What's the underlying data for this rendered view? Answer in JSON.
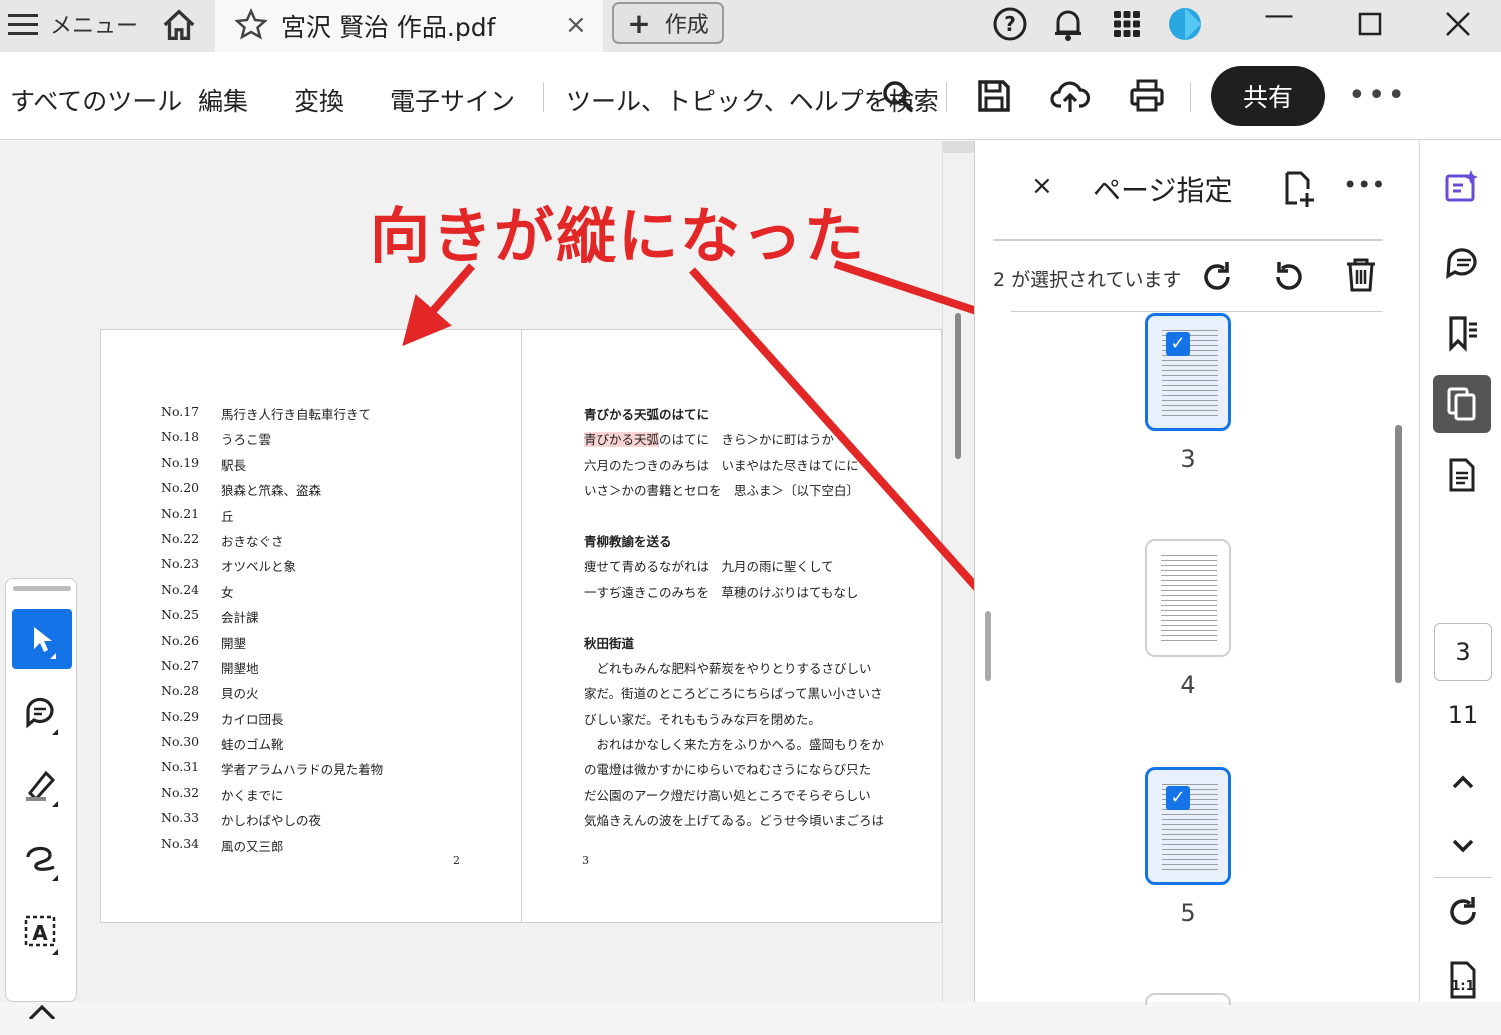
{
  "titlebar": {
    "menu_label": "メニュー",
    "tab_name": "宮沢 賢治 作品.pdf",
    "tab_close": "×",
    "create_label": "作成",
    "create_plus": "+"
  },
  "toolbar": {
    "all_tools": "すべてのツール",
    "edit": "編集",
    "convert": "変換",
    "esign": "電子サイン",
    "search": "ツール、トピック、ヘルプを検索",
    "share": "共有",
    "more": "•••"
  },
  "annotation": {
    "text": "向きが縦になった",
    "color": "#e32626"
  },
  "page2": {
    "entries": [
      {
        "no": "No.17",
        "title": "馬行き人行き自転車行きて"
      },
      {
        "no": "No.18",
        "title": "うろこ雲"
      },
      {
        "no": "No.19",
        "title": "駅長"
      },
      {
        "no": "No.20",
        "title": "狼森と笊森、盗森"
      },
      {
        "no": "No.21",
        "title": "丘"
      },
      {
        "no": "No.22",
        "title": "おきなぐさ"
      },
      {
        "no": "No.23",
        "title": "オツベルと象"
      },
      {
        "no": "No.24",
        "title": "女"
      },
      {
        "no": "No.25",
        "title": "会計課"
      },
      {
        "no": "No.26",
        "title": "開墾"
      },
      {
        "no": "No.27",
        "title": "開墾地"
      },
      {
        "no": "No.28",
        "title": "貝の火"
      },
      {
        "no": "No.29",
        "title": "カイロ団長"
      },
      {
        "no": "No.30",
        "title": "蛙のゴム靴"
      },
      {
        "no": "No.31",
        "title": "学者アラムハラドの見た着物"
      },
      {
        "no": "No.32",
        "title": "かくまでに"
      },
      {
        "no": "No.33",
        "title": "かしわばやしの夜"
      },
      {
        "no": "No.34",
        "title": "風の又三郎"
      }
    ],
    "page_number": "2"
  },
  "page3": {
    "s1_title": "青びかる天弧のはてに",
    "s1_l1_hl": "青びかる天弧",
    "s1_l1_rest": "のはてに　きら＞かに町はうか",
    "s1_l2": "六月のたつきのみちは　いまやはた尽きはてにに",
    "s1_l3": "いさ＞かの書籍とセロを　思ふま＞〔以下空白〕",
    "s2_title": "青柳教諭を送る",
    "s2_l1": "痩せて青めるながれは　九月の雨に聖くして",
    "s2_l2": "一すぢ遠きこのみちを　草穂のけぶりはてもなし",
    "s3_title": "秋田街道",
    "s3_l1": "　どれもみんな肥料や薪炭をやりとりするさびしい",
    "s3_l2": "家だ。街道のところどころにちらばって黒い小さいさ",
    "s3_l3": "びしい家だ。それももうみな戸を閉めた。",
    "s3_l4": "　おれはかなしく来た方をふりかへる。盛岡もりをか",
    "s3_l5": "の電燈は微かすかにゆらいでねむさうにならび只た",
    "s3_l6": "だ公園のアーク燈だけ高い処ところでそらぞらしい",
    "s3_l7": "気焔きえんの波を上げてゐる。どうせ今頃いまごろは",
    "page_number": "3"
  },
  "panel": {
    "close": "×",
    "title": "ページ指定",
    "more": "•••",
    "selection_info": "2 が選択されています",
    "thumbnails": [
      {
        "label": "3",
        "selected": true
      },
      {
        "label": "4",
        "selected": false
      },
      {
        "label": "5",
        "selected": true
      }
    ]
  },
  "rail": {
    "current_page": "3",
    "total_pages": "11"
  },
  "colors": {
    "accent": "#1473e6",
    "share_bg": "#1f1f1f",
    "annotation_red": "#e32626"
  }
}
